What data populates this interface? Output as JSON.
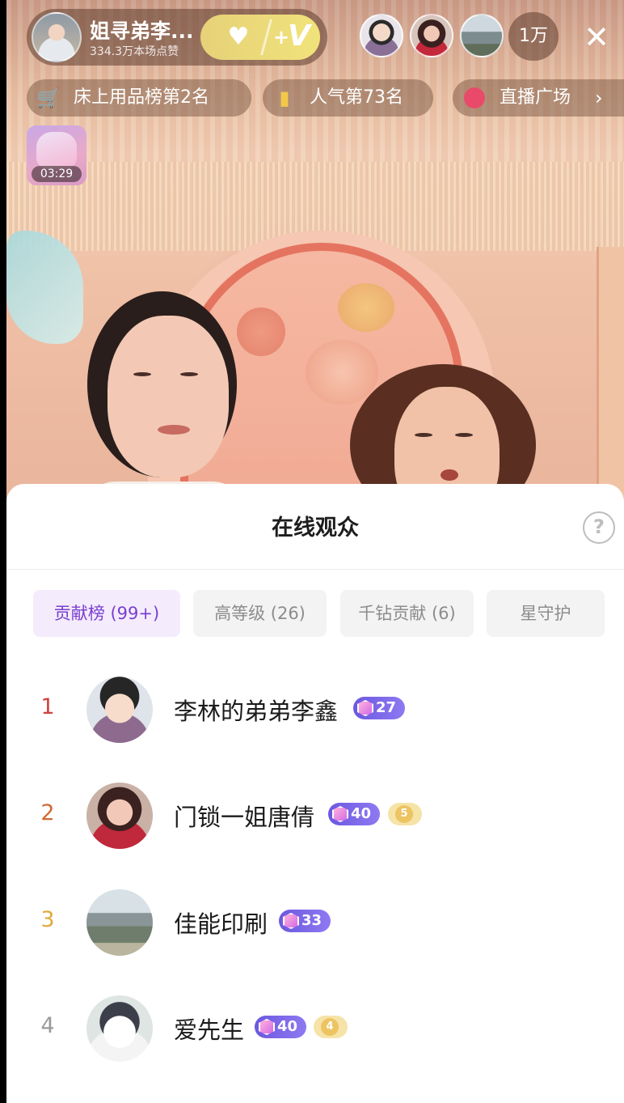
{
  "host": {
    "name": "姐寻弟李...",
    "likes": "334.3万本场点赞"
  },
  "fan_club": {
    "heart_icon": "heart-icon",
    "plus": "+",
    "v": "V"
  },
  "top_viewers_count": "1万",
  "chips": [
    {
      "icon": "cart-icon",
      "label": "床上用品榜第2名"
    },
    {
      "icon": "bar-chart-icon",
      "label": "人气第73名"
    },
    {
      "icon": "live-plaza-icon",
      "label": "直播广场"
    }
  ],
  "gift_timer": "03:29",
  "sheet": {
    "title": "在线观众",
    "help": "?",
    "tabs": [
      {
        "label": "贡献榜 (99+)",
        "active": true
      },
      {
        "label": "高等级 (26)",
        "active": false
      },
      {
        "label": "千钻贡献 (6)",
        "active": false
      },
      {
        "label": "星守护",
        "active": false
      }
    ],
    "rows": [
      {
        "rank": "1",
        "rank_color": "#d0413f",
        "name": "李林的弟弟李鑫",
        "level": "27"
      },
      {
        "rank": "2",
        "rank_color": "#d06a32",
        "name": "门锁一姐唐倩",
        "level": "40",
        "fan_level": "5"
      },
      {
        "rank": "3",
        "rank_color": "#e0aa3e",
        "name": "佳能印刷",
        "level": "33"
      },
      {
        "rank": "4",
        "rank_color": "#9a9a9a",
        "name": "爱先生",
        "level": "40",
        "fan_level": "4"
      }
    ]
  }
}
